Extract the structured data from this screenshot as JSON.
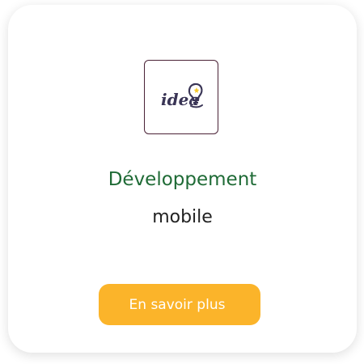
{
  "card": {
    "logo_text": "idea",
    "title": "Développement",
    "subtitle": "mobile",
    "button_label": "En savoir plus"
  },
  "colors": {
    "title": "#1f6b36",
    "button": "#fbb42a",
    "logo_ink": "#3a3556",
    "logo_bulb_accent": "#f7c928"
  },
  "icons": {
    "logo": "idea-lightbulb-icon"
  }
}
